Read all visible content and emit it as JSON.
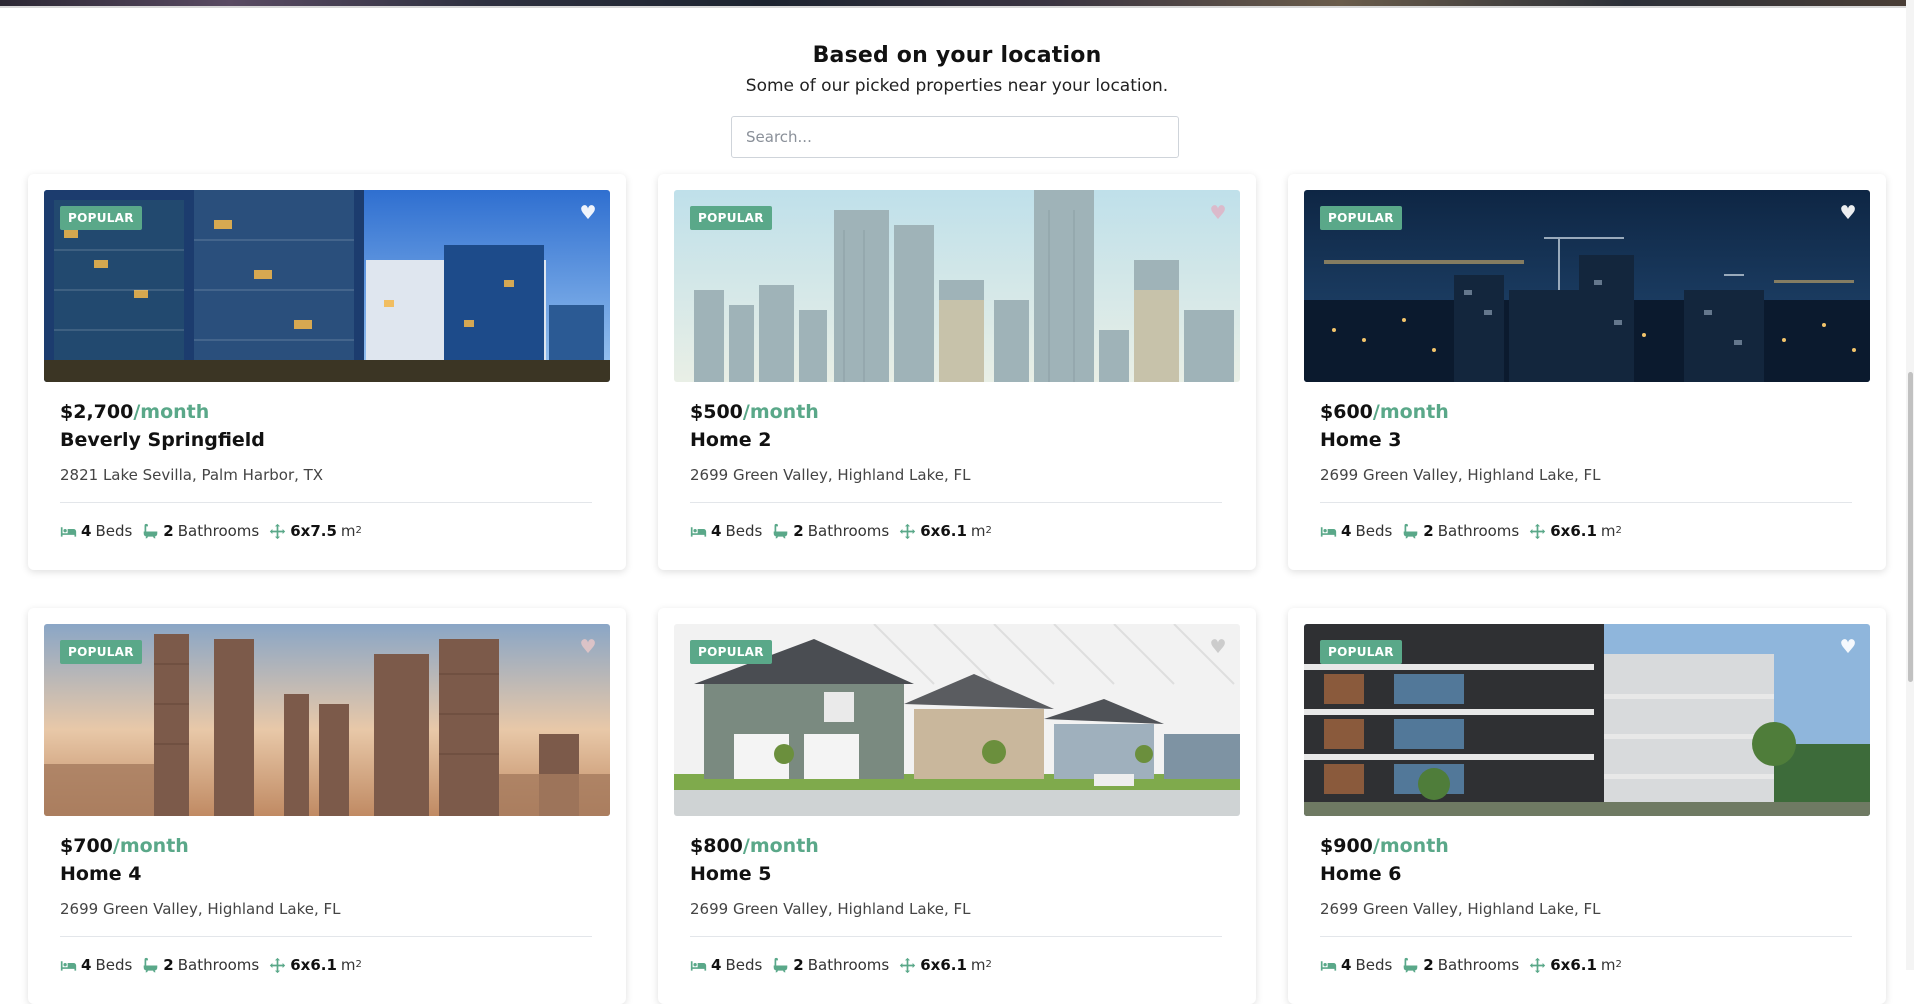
{
  "section": {
    "title": "Based on your location",
    "subtitle": "Some of our picked properties near your location."
  },
  "search": {
    "placeholder": "Search...",
    "value": ""
  },
  "colors": {
    "accent": "#5aa889",
    "badge": "#5aa889",
    "text": "#111111"
  },
  "icons": {
    "bed": "bed-icon",
    "bath": "bath-icon",
    "area": "move-arrows-icon",
    "favorite": "heart-icon"
  },
  "listings": [
    {
      "badge": "POPULAR",
      "price": "$2,700",
      "period": "/month",
      "title": "Beverly Springfield",
      "address": "2821 Lake Sevilla, Palm Harbor, TX",
      "beds_count": "4",
      "beds_label": "Beds",
      "baths_count": "2",
      "baths_label": "Bathrooms",
      "area": "6x7.5",
      "area_unit": "m",
      "area_exp": "2"
    },
    {
      "badge": "POPULAR",
      "price": "$500",
      "period": "/month",
      "title": "Home 2",
      "address": "2699 Green Valley, Highland Lake, FL",
      "beds_count": "4",
      "beds_label": "Beds",
      "baths_count": "2",
      "baths_label": "Bathrooms",
      "area": "6x6.1",
      "area_unit": "m",
      "area_exp": "2"
    },
    {
      "badge": "POPULAR",
      "price": "$600",
      "period": "/month",
      "title": "Home 3",
      "address": "2699 Green Valley, Highland Lake, FL",
      "beds_count": "4",
      "beds_label": "Beds",
      "baths_count": "2",
      "baths_label": "Bathrooms",
      "area": "6x6.1",
      "area_unit": "m",
      "area_exp": "2"
    },
    {
      "badge": "POPULAR",
      "price": "$700",
      "period": "/month",
      "title": "Home 4",
      "address": "2699 Green Valley, Highland Lake, FL",
      "beds_count": "4",
      "beds_label": "Beds",
      "baths_count": "2",
      "baths_label": "Bathrooms",
      "area": "6x6.1",
      "area_unit": "m",
      "area_exp": "2"
    },
    {
      "badge": "POPULAR",
      "price": "$800",
      "period": "/month",
      "title": "Home 5",
      "address": "2699 Green Valley, Highland Lake, FL",
      "beds_count": "4",
      "beds_label": "Beds",
      "baths_count": "2",
      "baths_label": "Bathrooms",
      "area": "6x6.1",
      "area_unit": "m",
      "area_exp": "2"
    },
    {
      "badge": "POPULAR",
      "price": "$900",
      "period": "/month",
      "title": "Home 6",
      "address": "2699 Green Valley, Highland Lake, FL",
      "beds_count": "4",
      "beds_label": "Beds",
      "baths_count": "2",
      "baths_label": "Bathrooms",
      "area": "6x6.1",
      "area_unit": "m",
      "area_exp": "2"
    }
  ]
}
